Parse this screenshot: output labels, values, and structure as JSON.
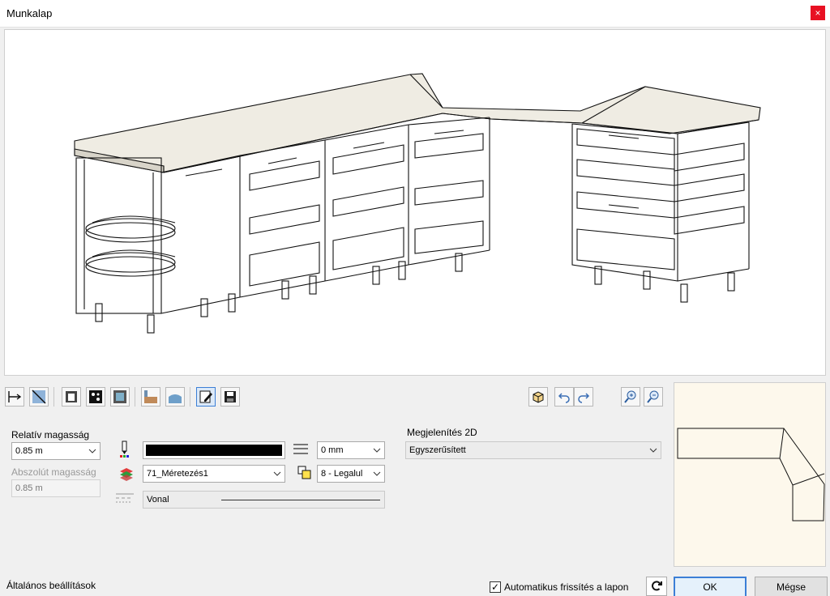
{
  "window": {
    "title": "Munkalap",
    "close_glyph": "×"
  },
  "toolbar": {
    "left_icons": [
      "dimension-icon",
      "diagonal-icon",
      "front-view-icon",
      "texture-icon",
      "frame-icon",
      "hatch-icon",
      "profile-icon",
      "edit-icon",
      "save-icon"
    ],
    "right_icons": [
      "cube-icon",
      "undo-icon",
      "redo-icon",
      "zoom-in-icon",
      "zoom-out-icon"
    ]
  },
  "props": {
    "rel_height_label": "Relatív magasság",
    "rel_height_value": "0.85 m",
    "abs_height_label": "Abszolút magasság",
    "abs_height_value": "0.85 m",
    "line_color": "#000000",
    "line_width_value": "0 mm",
    "layer_value": "71_Méretezés1",
    "order_value": "8 - Legalul",
    "line_type_value": "Vonal"
  },
  "display2d": {
    "label": "Megjelenítés 2D",
    "value": "Egyszerűsített"
  },
  "footer": {
    "general_settings": "Általános beállítások",
    "auto_refresh_label": "Automatikus frissítés a lapon",
    "auto_refresh_checked": "✓",
    "ok": "OK",
    "cancel": "Mégse"
  }
}
